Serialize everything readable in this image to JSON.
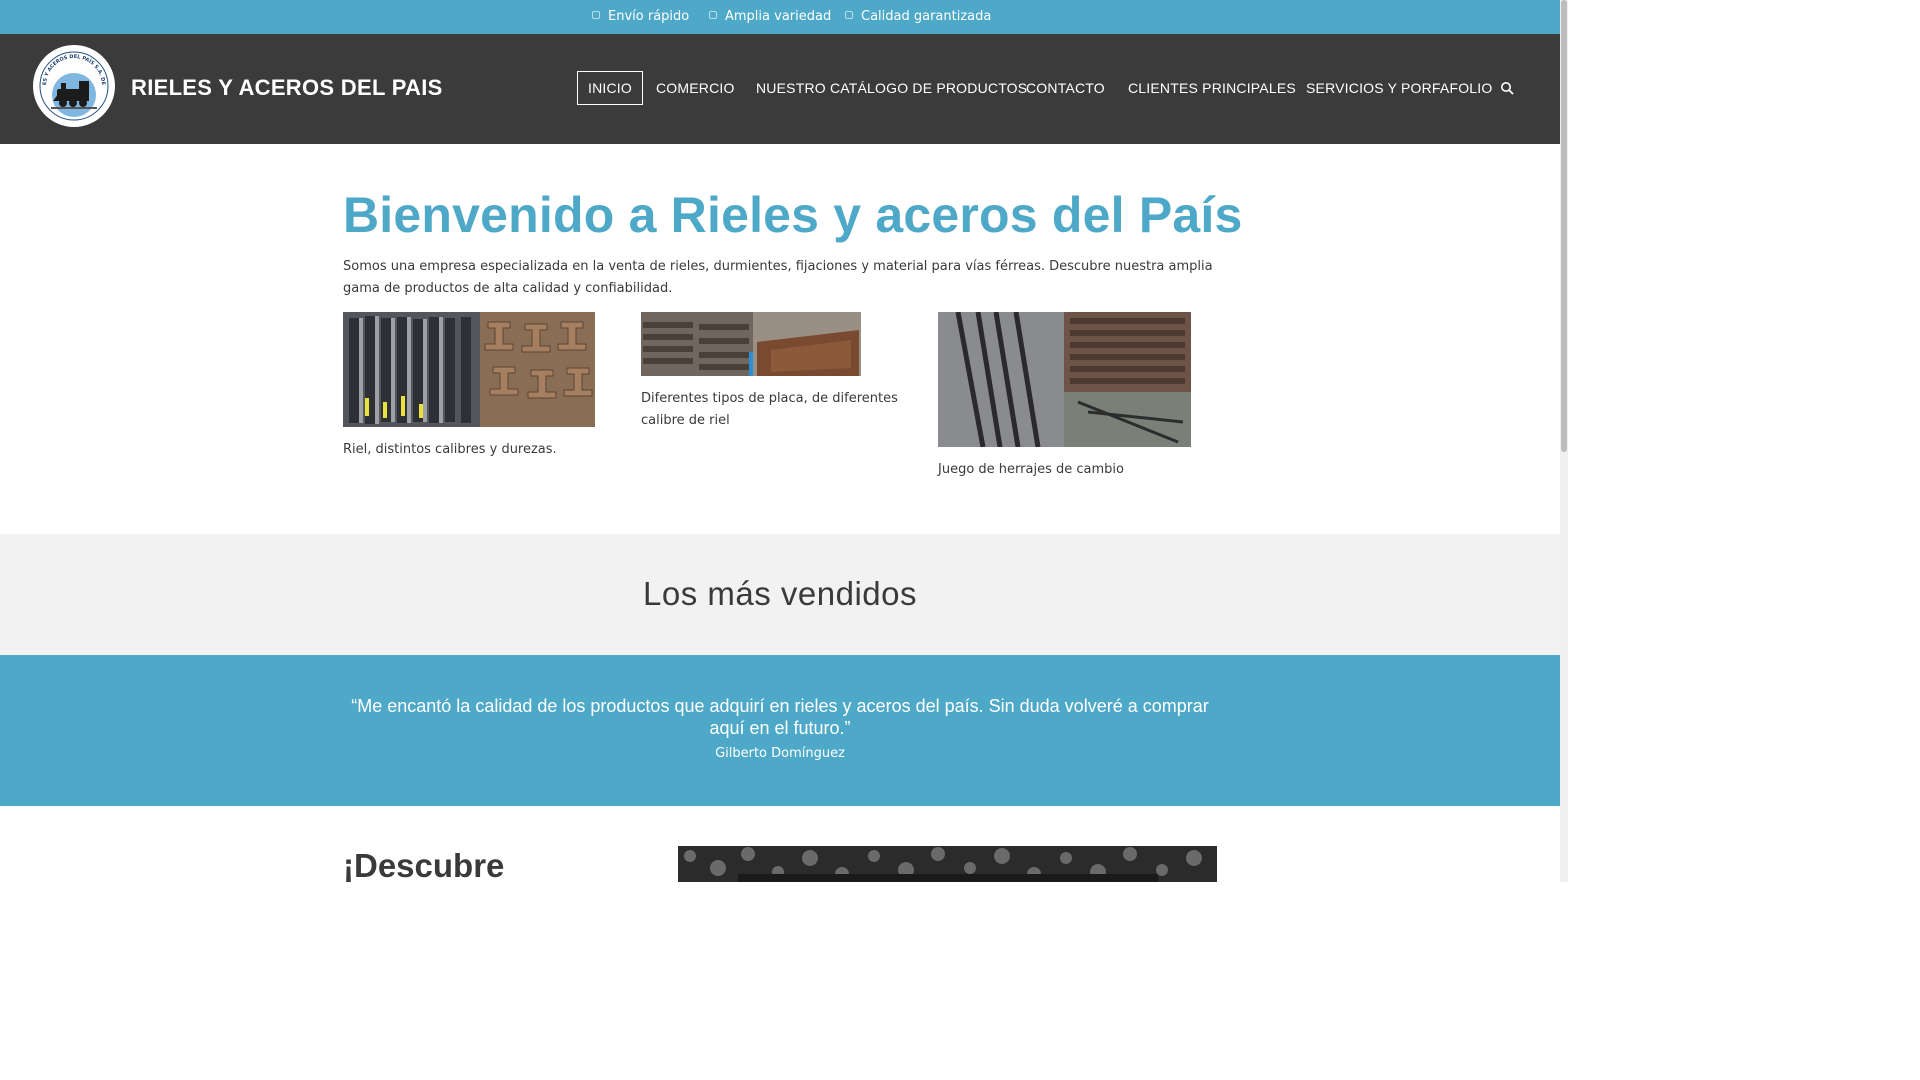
{
  "topbar": {
    "items": [
      {
        "label": "Envío rápido",
        "icon": "truck-icon"
      },
      {
        "label": "Amplia variedad",
        "icon": "list-icon"
      },
      {
        "label": "Calidad garantizada",
        "icon": "check-icon"
      }
    ]
  },
  "header": {
    "site_title": "RIELES Y ACEROS DEL PAIS",
    "logo_text": "RIELES Y ACEROS DEL PAÍS S.A. DE C.V.",
    "nav": [
      {
        "label": "INICIO",
        "active": true
      },
      {
        "label": "COMERCIO",
        "active": false
      },
      {
        "label": "NUESTRO CATÁLOGO DE PRODUCTOS",
        "active": false
      },
      {
        "label": "CONTACTO",
        "active": false
      },
      {
        "label": "CLIENTES PRINCIPALES",
        "active": false
      },
      {
        "label": "SERVICIOS Y PORFAFOLIO",
        "active": false
      }
    ]
  },
  "welcome": {
    "title": "Bienvenido a Rieles y aceros del País",
    "text": "Somos una empresa especializada en la venta de rieles, durmientes, fijaciones y material para vías férreas. Descubre nuestra amplia gama de productos de alta calidad y confiabilidad."
  },
  "products": [
    {
      "caption": "Riel, distintos calibres y durezas."
    },
    {
      "caption": "Diferentes tipos de placa, de diferentes calibre de riel"
    },
    {
      "caption": "Juego de herrajes de cambio"
    }
  ],
  "bestsellers": {
    "title": "Los más vendidos"
  },
  "testimonial": {
    "quote": "“Me encantó la calidad de los productos que adquirí en rieles y aceros del país. Sin duda volveré a comprar aquí en el futuro.”",
    "author": "Gilberto Domínguez"
  },
  "discover": {
    "title": "¡Descubre"
  },
  "colors": {
    "accent": "#4ea9c9",
    "header_bg": "#3b3b3b",
    "section_bg": "#f2f2f2",
    "text": "#3a3a3a"
  }
}
